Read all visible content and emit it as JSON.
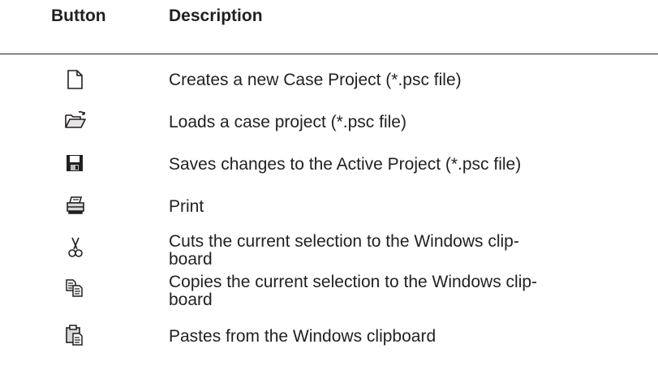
{
  "header": {
    "button_label": "Button",
    "description_label": "Description"
  },
  "rows": [
    {
      "icon": "new-file-icon",
      "description": "Creates a new Case Project (*.psc file)"
    },
    {
      "icon": "open-folder-icon",
      "description": "Loads a case project (*.psc file)"
    },
    {
      "icon": "save-disk-icon",
      "description": "Saves changes to the Active Project (*.psc file)"
    },
    {
      "icon": "printer-icon",
      "description": "Print"
    },
    {
      "icon": "scissors-icon",
      "description": "Cuts the current selection to the Windows clip-\nboard"
    },
    {
      "icon": "copy-icon",
      "description": "Copies the current selection to the Windows clip-\nboard"
    },
    {
      "icon": "paste-clipboard-icon",
      "description": "Pastes from the Windows clipboard"
    }
  ]
}
